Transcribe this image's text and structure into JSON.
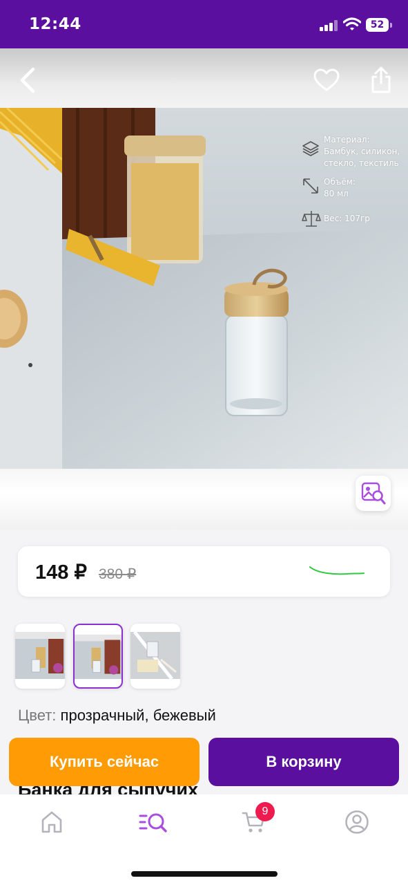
{
  "status_bar": {
    "time": "12:44",
    "battery": "52"
  },
  "header": {
    "back_icon": "chevron-left-icon",
    "favorite_icon": "heart-icon",
    "share_icon": "share-icon"
  },
  "product_image": {
    "specs": {
      "material_label": "Материал:",
      "material_line1": "Бамбук, силикон,",
      "material_line2": "стекло, текстиль",
      "volume_label": "Объём:",
      "volume_value": "80 мл",
      "weight": "Вес: 107гр"
    },
    "image_search_icon": "image-search-icon"
  },
  "price": {
    "current": "148 ₽",
    "old": "380 ₽"
  },
  "thumbnails": {
    "count": 3,
    "selected_index": 1
  },
  "color": {
    "label": "Цвет:",
    "value": "прозрачный, бежевый"
  },
  "actions": {
    "buy_now": "Купить сейчас",
    "add_to_cart": "В корзину"
  },
  "title_peek": "Банка  для сыпучих",
  "bottom_nav": {
    "items": [
      "home-icon",
      "catalog-search-icon",
      "cart-icon",
      "profile-icon"
    ],
    "cart_badge": "9",
    "accent": "#a84ddc",
    "inactive": "#b3b3bb"
  },
  "colors": {
    "brand_purple": "#5a0f9e",
    "orange": "#ff9b05",
    "badge_red": "#ee1b4f"
  }
}
